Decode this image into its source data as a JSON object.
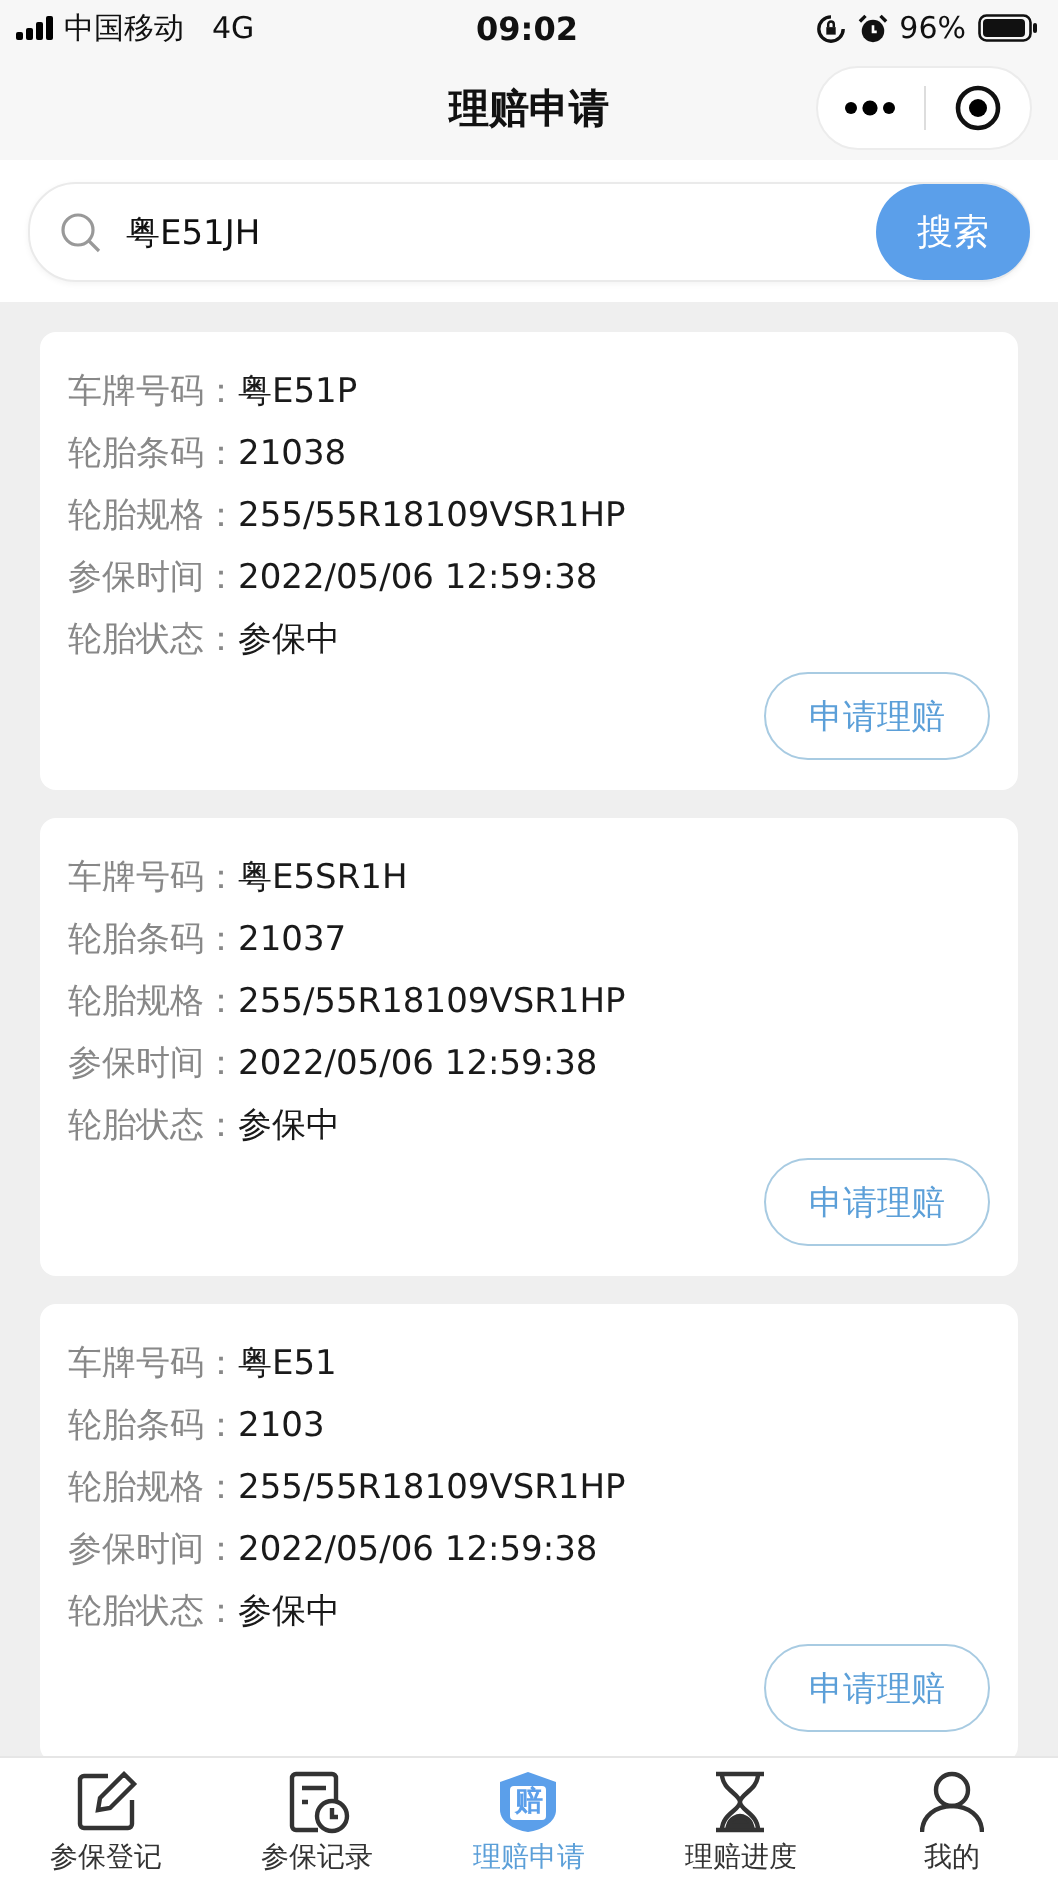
{
  "status_bar": {
    "carrier": "中国移动",
    "network": "4G",
    "time": "09:02",
    "battery": "96%"
  },
  "nav_bar": {
    "title": "理赔申请"
  },
  "search": {
    "value": "粤E51JH",
    "button": "搜索"
  },
  "cards": [
    {
      "fields": [
        {
          "label": "车牌号码：",
          "value": "粤E51P"
        },
        {
          "label": "轮胎条码：",
          "value": "21038"
        },
        {
          "label": "轮胎规格：",
          "value": "255/55R18109VSR1HP"
        },
        {
          "label": "参保时间：",
          "value": "2022/05/06 12:59:38"
        },
        {
          "label": "轮胎状态：",
          "value": "参保中"
        }
      ],
      "button": "申请理赔"
    },
    {
      "fields": [
        {
          "label": "车牌号码：",
          "value": "粤E5SR1H"
        },
        {
          "label": "轮胎条码：",
          "value": "21037"
        },
        {
          "label": "轮胎规格：",
          "value": "255/55R18109VSR1HP"
        },
        {
          "label": "参保时间：",
          "value": "2022/05/06 12:59:38"
        },
        {
          "label": "轮胎状态：",
          "value": "参保中"
        }
      ],
      "button": "申请理赔"
    },
    {
      "fields": [
        {
          "label": "车牌号码：",
          "value": "粤E51"
        },
        {
          "label": "轮胎条码：",
          "value": "2103"
        },
        {
          "label": "轮胎规格：",
          "value": "255/55R18109VSR1HP"
        },
        {
          "label": "参保时间：",
          "value": "2022/05/06 12:59:38"
        },
        {
          "label": "轮胎状态：",
          "value": "参保中"
        }
      ],
      "button": "申请理赔"
    }
  ],
  "tab_bar": [
    {
      "label": "参保登记",
      "kind": "edit",
      "selected": false
    },
    {
      "label": "参保记录",
      "kind": "record",
      "selected": false
    },
    {
      "label": "理赔申请",
      "kind": "claim",
      "badge": "赔",
      "selected": true
    },
    {
      "label": "理赔进度",
      "kind": "progress",
      "selected": false
    },
    {
      "label": "我的",
      "kind": "profile",
      "selected": false
    }
  ]
}
